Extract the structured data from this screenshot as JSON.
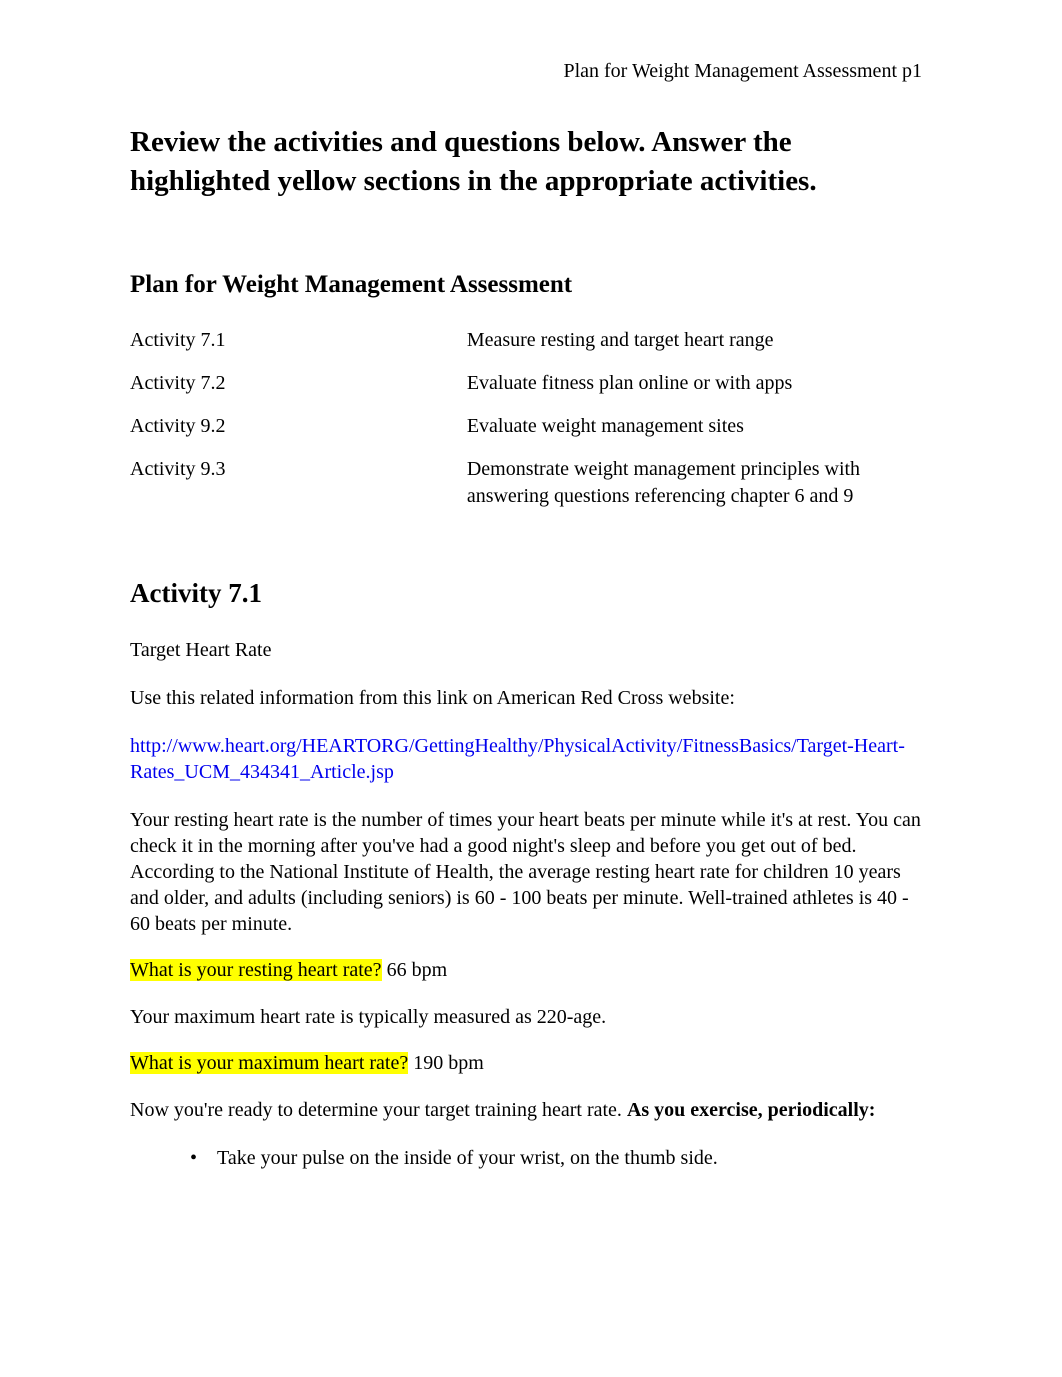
{
  "header": {
    "running_head": "Plan for Weight Management Assessment p1"
  },
  "instruction": "Review the activities and questions below. Answer the highlighted yellow sections in the appropriate activities.",
  "plan": {
    "title": "Plan for Weight Management Assessment",
    "rows": [
      {
        "label": "Activity 7.1",
        "desc": "Measure resting and target heart range"
      },
      {
        "label": "Activity 7.2",
        "desc": "Evaluate fitness plan online or with apps"
      },
      {
        "label": "Activity 9.2",
        "desc": "Evaluate weight management sites"
      },
      {
        "label": "Activity 9.3",
        "desc": "Demonstrate weight management principles with answering questions referencing chapter 6 and 9"
      }
    ]
  },
  "activity71": {
    "heading": "Activity 7.1",
    "subheading": "Target Heart Rate",
    "intro": "Use this related information from this link on American Red Cross website:",
    "link": "http://www.heart.org/HEARTORG/GettingHealthy/PhysicalActivity/FitnessBasics/Target-Heart-Rates_UCM_434341_Article.jsp",
    "resting_paragraph": "Your resting heart rate is the number of times your heart beats per minute while it's at rest. You can check it in the morning after you've had a good night's sleep and before you get out of bed. According to the National Institute of Health, the average resting heart rate for children 10 years and older, and adults (including seniors) is 60 - 100 beats per minute. Well-trained athletes is 40 - 60 beats per minute.",
    "q1_question": "What is your resting heart rate?",
    "q1_answer": " 66 bpm",
    "max_paragraph": "Your maximum heart rate is typically measured as 220-age.",
    "q2_question": "What is your maximum heart rate?",
    "q2_answer": " 190 bpm",
    "target_intro_a": "Now you're ready to determine your target training heart rate. ",
    "target_intro_b": "As you exercise, periodically:",
    "bullet1": "Take your pulse on the inside of your wrist, on the thumb side."
  }
}
